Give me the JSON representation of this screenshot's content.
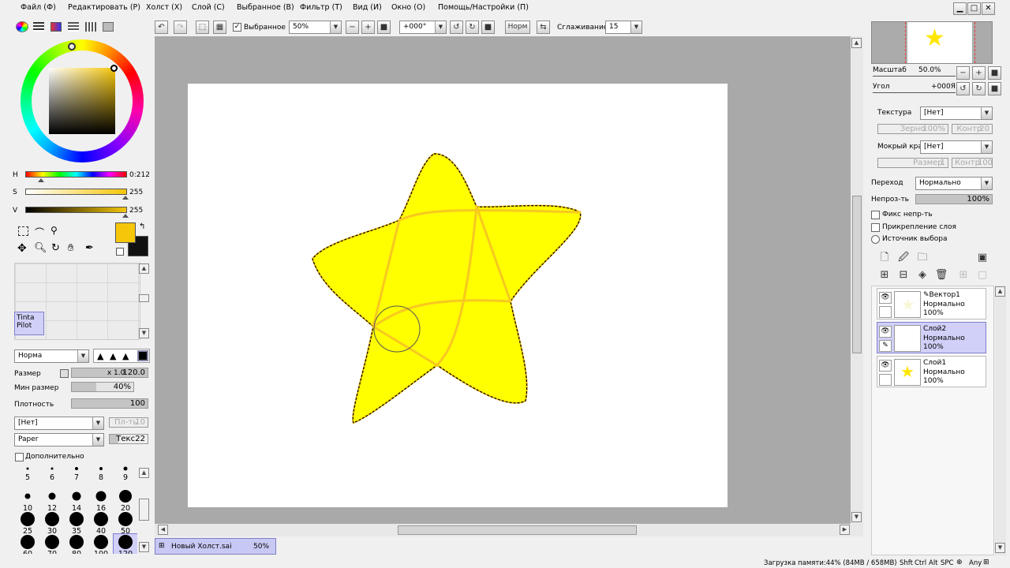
{
  "menu": [
    "Файл (Ф)",
    "Редактировать (Р)",
    "Холст (Х)",
    "Слой (С)",
    "Выбранное (В)",
    "Фильтр (Т)",
    "Вид (И)",
    "Окно (О)",
    "Помощь/Настройки (П)"
  ],
  "toolbar": {
    "selection_label": "Выбранное",
    "zoom_value": "50%",
    "angle_value": "+000°",
    "mode_button": "Норм",
    "smoothing_label": "Сглаживание",
    "smoothing_value": "15"
  },
  "color": {
    "current": "#f5c60a",
    "secondary": "#111111",
    "h_label": "H",
    "h_value": "0:212",
    "s_label": "S",
    "s_value": "255",
    "v_label": "V",
    "v_value": "255"
  },
  "brush": {
    "tool_name_line1": "Tinta",
    "tool_name_line2": "Pilot",
    "blend_mode": "Норма",
    "size_label": "Размер",
    "size_multiplier": "x 1.0",
    "size_value": "120.0",
    "min_size_label": "Мин размер",
    "min_size_value": "40%",
    "density_label": "Плотность",
    "density_value": "100",
    "texture_select": "[Нет]",
    "texture_strength": "Пл-ть",
    "texture_strength_value": "10",
    "paper_select": "Paper",
    "tex_label": "Текс.",
    "tex_value": "22",
    "advanced_label": "Дополнительно",
    "sizes": [
      "5",
      "6",
      "7",
      "8",
      "9",
      "10",
      "12",
      "14",
      "16",
      "20",
      "25",
      "30",
      "35",
      "40",
      "50",
      "60",
      "70",
      "80",
      "100",
      "120"
    ]
  },
  "navigator": {
    "scale_label": "Масштаб",
    "scale_value": "50.0%",
    "angle_label": "Угол",
    "angle_value": "+000Я"
  },
  "layer_props": {
    "texture_label": "Текстура",
    "texture_value": "[Нет]",
    "grain_label": "Зерно",
    "grain_value": "100%",
    "contrast_label": "Контр",
    "contrast_value": "20",
    "wet_edge_label": "Мокрый край",
    "wet_edge_value": "[Нет]",
    "size_label": "Размер",
    "size_value": "1",
    "contrast2_label": "Контр",
    "contrast2_value": "100",
    "blend_label": "Переход",
    "blend_value": "Нормально",
    "opacity_label": "Непроз-ть",
    "opacity_value": "100%",
    "fix_opacity": "Фикс непр-ть",
    "clip_layer": "Прикрепление слоя",
    "selection_source": "Источник выбора"
  },
  "layers": [
    {
      "name": "Вектор1",
      "mode": "Нормально",
      "opacity": "100%"
    },
    {
      "name": "Слой2",
      "mode": "Нормально",
      "opacity": "100%"
    },
    {
      "name": "Слой1",
      "mode": "Нормально",
      "opacity": "100%"
    }
  ],
  "document_tab": {
    "name": "Новый Холст.sai",
    "zoom": "50%"
  },
  "status": {
    "memory": "Загрузка памяти:44% (84MB / 658MB)",
    "keys": [
      "Shft",
      "Ctrl",
      "Alt",
      "SPC",
      "Any"
    ]
  }
}
